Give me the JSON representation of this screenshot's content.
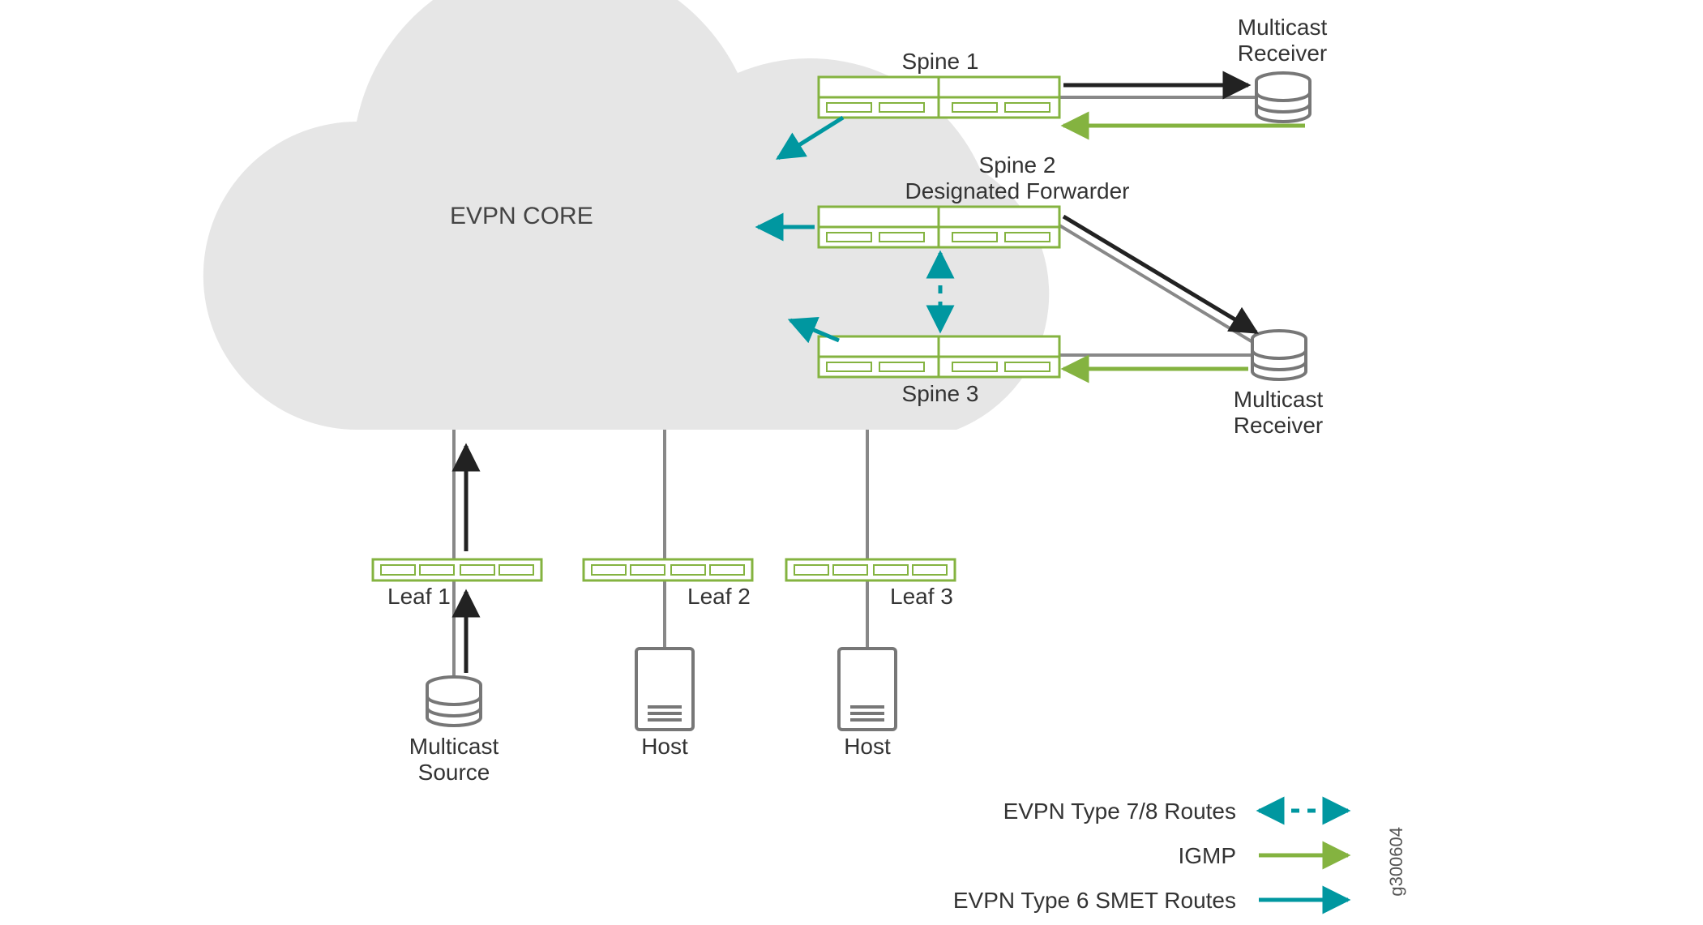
{
  "core": {
    "label": "EVPN CORE"
  },
  "nodes": {
    "spine1": {
      "label": "Spine 1"
    },
    "spine2": {
      "label": "Spine 2\nDesignated Forwarder"
    },
    "spine3": {
      "label": "Spine 3"
    },
    "leaf1": {
      "label": "Leaf 1"
    },
    "leaf2": {
      "label": "Leaf 2"
    },
    "leaf3": {
      "label": "Leaf 3"
    },
    "msrc": {
      "label": "Multicast\nSource"
    },
    "host2": {
      "label": "Host"
    },
    "host3": {
      "label": "Host"
    },
    "mrcv_top": {
      "label": "Multicast\nReceiver"
    },
    "mrcv_right": {
      "label": "Multicast\nReceiver"
    }
  },
  "legend": {
    "type78": "EVPN Type 7/8 Routes",
    "igmp": "IGMP",
    "type6": "EVPN Type 6 SMET Routes"
  },
  "figure_id": "g300604",
  "colors": {
    "green": "#84B340",
    "teal": "#0097A0",
    "grey": "#888888",
    "cloud": "#E6E6E6",
    "black": "#222222"
  },
  "chart_data": {
    "type": "network-diagram",
    "nodes": [
      {
        "id": "core",
        "kind": "cloud",
        "label": "EVPN CORE"
      },
      {
        "id": "spine1",
        "kind": "switch",
        "label": "Spine 1"
      },
      {
        "id": "spine2",
        "kind": "switch",
        "label": "Spine 2",
        "role": "Designated Forwarder"
      },
      {
        "id": "spine3",
        "kind": "switch",
        "label": "Spine 3"
      },
      {
        "id": "leaf1",
        "kind": "switch",
        "label": "Leaf 1"
      },
      {
        "id": "leaf2",
        "kind": "switch",
        "label": "Leaf 2"
      },
      {
        "id": "leaf3",
        "kind": "switch",
        "label": "Leaf 3"
      },
      {
        "id": "msrc",
        "kind": "db",
        "label": "Multicast Source"
      },
      {
        "id": "host2",
        "kind": "host",
        "label": "Host"
      },
      {
        "id": "host3",
        "kind": "host",
        "label": "Host"
      },
      {
        "id": "mrcv_top",
        "kind": "db",
        "label": "Multicast Receiver"
      },
      {
        "id": "mrcv_right",
        "kind": "db",
        "label": "Multicast Receiver"
      }
    ],
    "edges": [
      {
        "from": "core",
        "to": "leaf1",
        "style": "plain"
      },
      {
        "from": "core",
        "to": "leaf2",
        "style": "plain"
      },
      {
        "from": "core",
        "to": "leaf3",
        "style": "plain"
      },
      {
        "from": "leaf2",
        "to": "host2",
        "style": "plain"
      },
      {
        "from": "leaf3",
        "to": "host3",
        "style": "plain"
      },
      {
        "from": "leaf1",
        "to": "msrc",
        "style": "plain"
      },
      {
        "from": "msrc",
        "to": "leaf1",
        "style": "traffic",
        "arrow": "to"
      },
      {
        "from": "leaf1",
        "to": "core",
        "style": "traffic",
        "arrow": "to"
      },
      {
        "from": "spine1",
        "to": "mrcv_top",
        "style": "plain"
      },
      {
        "from": "spine1",
        "to": "mrcv_top",
        "style": "traffic",
        "arrow": "to"
      },
      {
        "from": "mrcv_top",
        "to": "spine1",
        "style": "igmp",
        "arrow": "to"
      },
      {
        "from": "spine1",
        "to": "core",
        "style": "type6",
        "arrow": "to"
      },
      {
        "from": "spine2",
        "to": "mrcv_right",
        "style": "plain"
      },
      {
        "from": "spine3",
        "to": "mrcv_right",
        "style": "plain"
      },
      {
        "from": "spine2",
        "to": "mrcv_right",
        "style": "traffic",
        "arrow": "to"
      },
      {
        "from": "mrcv_right",
        "to": "spine3",
        "style": "igmp",
        "arrow": "to"
      },
      {
        "from": "spine2",
        "to": "core",
        "style": "type6",
        "arrow": "to"
      },
      {
        "from": "spine3",
        "to": "core",
        "style": "type6",
        "arrow": "to"
      },
      {
        "from": "spine2",
        "to": "spine3",
        "style": "type78",
        "arrow": "both",
        "dashed": true
      }
    ],
    "legend": [
      {
        "key": "type78",
        "text": "EVPN Type 7/8 Routes",
        "style": "dashed-double-arrow",
        "color": "#0097A0"
      },
      {
        "key": "igmp",
        "text": "IGMP",
        "style": "solid-arrow",
        "color": "#84B340"
      },
      {
        "key": "type6",
        "text": "EVPN Type 6 SMET Routes",
        "style": "solid-arrow",
        "color": "#0097A0"
      }
    ]
  }
}
